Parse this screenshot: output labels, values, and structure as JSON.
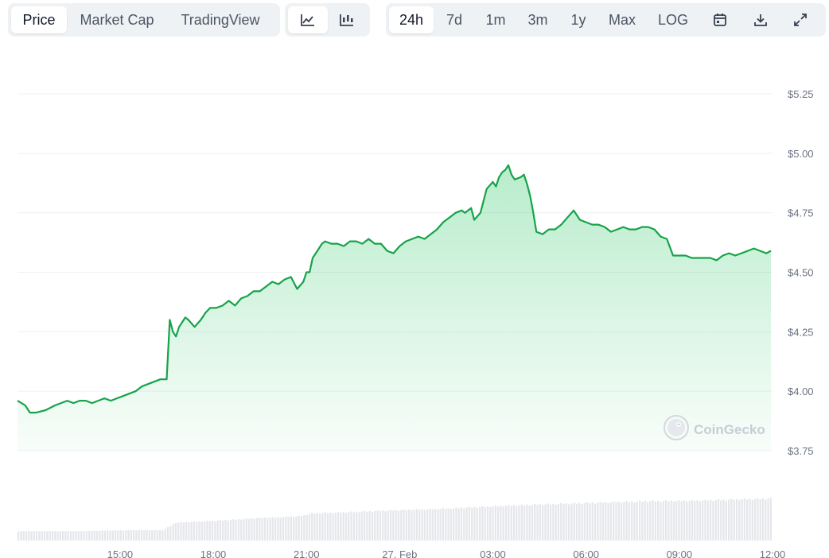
{
  "toolbar": {
    "views": [
      {
        "label": "Price",
        "active": true
      },
      {
        "label": "Market Cap",
        "active": false
      },
      {
        "label": "TradingView",
        "active": false
      }
    ],
    "chart_types": [
      {
        "icon": "line-chart-icon",
        "active": true
      },
      {
        "icon": "candlestick-chart-icon",
        "active": false
      }
    ],
    "ranges": [
      {
        "label": "24h",
        "active": true
      },
      {
        "label": "7d",
        "active": false
      },
      {
        "label": "1m",
        "active": false
      },
      {
        "label": "3m",
        "active": false
      },
      {
        "label": "1y",
        "active": false
      },
      {
        "label": "Max",
        "active": false
      },
      {
        "label": "LOG",
        "active": false
      }
    ],
    "tools": [
      {
        "icon": "calendar-icon"
      },
      {
        "icon": "download-icon"
      },
      {
        "icon": "expand-icon"
      }
    ]
  },
  "watermark": {
    "text": "CoinGecko",
    "icon": "coingecko-logo-icon"
  },
  "colors": {
    "line": "#16a34a",
    "fill": "#22c55e",
    "volume": "#e5e7eb",
    "grid": "#eef0f3",
    "axis_text": "#6b7280"
  },
  "chart_data": {
    "type": "area",
    "title": "",
    "xlabel": "",
    "ylabel": "",
    "x_ticks": [
      "15:00",
      "18:00",
      "21:00",
      "27. Feb",
      "03:00",
      "06:00",
      "09:00",
      "12:00"
    ],
    "x_tick_hours": [
      3,
      6,
      9,
      12,
      15,
      18,
      21,
      24
    ],
    "xlim_hours": [
      -0.3,
      24.0
    ],
    "y_ticks": [
      "$3.75",
      "$4.00",
      "$4.25",
      "$4.50",
      "$4.75",
      "$5.00",
      "$5.25"
    ],
    "y_tick_values": [
      3.75,
      4.0,
      4.25,
      4.5,
      4.75,
      5.0,
      5.25
    ],
    "ylim": [
      3.75,
      5.25
    ],
    "grid": true,
    "series": [
      {
        "x_hours": [
          -0.3,
          -0.05,
          0.1,
          0.3,
          0.6,
          0.9,
          1.1,
          1.3,
          1.5,
          1.7,
          1.9,
          2.1,
          2.3,
          2.5,
          2.7,
          2.9,
          3.1,
          3.3,
          3.5,
          3.7,
          3.9,
          4.1,
          4.3,
          4.5,
          4.6,
          4.7,
          4.8,
          4.9,
          5.0,
          5.1,
          5.2,
          5.4,
          5.6,
          5.75,
          5.9,
          6.1,
          6.3,
          6.5,
          6.7,
          6.9,
          7.1,
          7.3,
          7.5,
          7.7,
          7.9,
          8.1,
          8.3,
          8.5,
          8.7,
          8.9,
          9.0,
          9.1,
          9.2,
          9.3,
          9.4,
          9.5,
          9.6,
          9.8,
          10.0,
          10.2,
          10.4,
          10.6,
          10.8,
          11.0,
          11.2,
          11.4,
          11.6,
          11.8,
          12.0,
          12.2,
          12.4,
          12.6,
          12.8,
          13.0,
          13.2,
          13.4,
          13.6,
          13.8,
          14.0,
          14.1,
          14.2,
          14.3,
          14.4,
          14.6,
          14.8,
          15.0,
          15.1,
          15.2,
          15.3,
          15.4,
          15.5,
          15.6,
          15.7,
          15.9,
          16.0,
          16.1,
          16.2,
          16.3,
          16.4,
          16.6,
          16.8,
          17.0,
          17.2,
          17.4,
          17.6,
          17.8,
          18.0,
          18.2,
          18.4,
          18.6,
          18.8,
          19.0,
          19.2,
          19.4,
          19.6,
          19.8,
          20.0,
          20.2,
          20.4,
          20.6,
          20.8,
          21.0,
          21.2,
          21.4,
          21.6,
          21.8,
          22.0,
          22.2,
          22.4,
          22.6,
          22.8,
          23.0,
          23.2,
          23.4,
          23.6,
          23.8,
          23.95
        ],
        "y": [
          3.96,
          3.94,
          3.91,
          3.91,
          3.92,
          3.94,
          3.95,
          3.96,
          3.95,
          3.96,
          3.96,
          3.95,
          3.96,
          3.97,
          3.96,
          3.97,
          3.98,
          3.99,
          4.0,
          4.02,
          4.03,
          4.04,
          4.05,
          4.05,
          4.3,
          4.25,
          4.23,
          4.27,
          4.29,
          4.31,
          4.3,
          4.27,
          4.3,
          4.33,
          4.35,
          4.35,
          4.36,
          4.38,
          4.36,
          4.39,
          4.4,
          4.42,
          4.42,
          4.44,
          4.46,
          4.45,
          4.47,
          4.48,
          4.43,
          4.46,
          4.5,
          4.5,
          4.56,
          4.58,
          4.6,
          4.62,
          4.63,
          4.62,
          4.62,
          4.61,
          4.63,
          4.63,
          4.62,
          4.64,
          4.62,
          4.62,
          4.59,
          4.58,
          4.61,
          4.63,
          4.64,
          4.65,
          4.64,
          4.66,
          4.68,
          4.71,
          4.73,
          4.75,
          4.76,
          4.75,
          4.76,
          4.77,
          4.72,
          4.75,
          4.85,
          4.88,
          4.86,
          4.9,
          4.92,
          4.93,
          4.95,
          4.91,
          4.89,
          4.9,
          4.91,
          4.87,
          4.82,
          4.75,
          4.67,
          4.66,
          4.68,
          4.68,
          4.7,
          4.73,
          4.76,
          4.72,
          4.71,
          4.7,
          4.7,
          4.69,
          4.67,
          4.68,
          4.69,
          4.68,
          4.68,
          4.69,
          4.69,
          4.68,
          4.65,
          4.64,
          4.57,
          4.57,
          4.57,
          4.56,
          4.56,
          4.56,
          4.56,
          4.55,
          4.57,
          4.58,
          4.57,
          4.58,
          4.59,
          4.6,
          4.59,
          4.58,
          4.59
        ]
      }
    ],
    "volume": {
      "x_hours": [
        -0.3,
        0.5,
        1.5,
        2.5,
        3.5,
        4.4,
        4.8,
        6.0,
        7.5,
        8.8,
        9.2,
        10.5,
        12.0,
        13.5,
        14.0,
        15.0,
        16.0,
        17.0,
        18.0,
        19.0,
        20.0,
        21.0,
        22.0,
        23.0,
        24.0
      ],
      "relative": [
        0.2,
        0.2,
        0.2,
        0.21,
        0.22,
        0.22,
        0.38,
        0.42,
        0.48,
        0.52,
        0.58,
        0.61,
        0.65,
        0.68,
        0.7,
        0.73,
        0.76,
        0.78,
        0.8,
        0.82,
        0.84,
        0.85,
        0.86,
        0.88,
        0.9
      ]
    }
  }
}
